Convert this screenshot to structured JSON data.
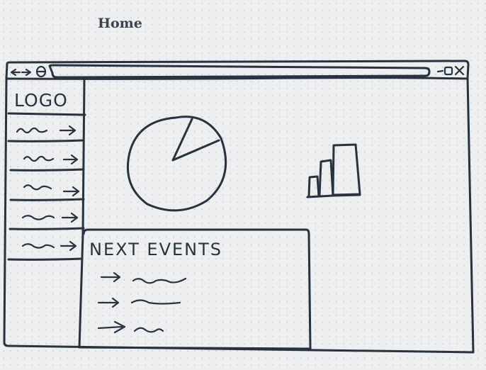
{
  "page": {
    "title": "Home"
  },
  "wireframe": {
    "logo": "LOGO",
    "nav_items": [
      {
        "icon": "squiggle-arrow-icon"
      },
      {
        "icon": "squiggle-arrow-icon"
      },
      {
        "icon": "squiggle-arrow-icon"
      },
      {
        "icon": "squiggle-arrow-icon"
      },
      {
        "icon": "squiggle-arrow-icon"
      }
    ],
    "events_heading": "NEXT EVENTS",
    "event_items": [
      {
        "icon": "arrow-right-icon"
      },
      {
        "icon": "arrow-right-icon"
      },
      {
        "icon": "arrow-right-icon"
      }
    ],
    "widgets": [
      "pie-chart-icon",
      "bar-chart-icon"
    ],
    "ink_color": "#283340",
    "background_color": "#eceeef"
  }
}
